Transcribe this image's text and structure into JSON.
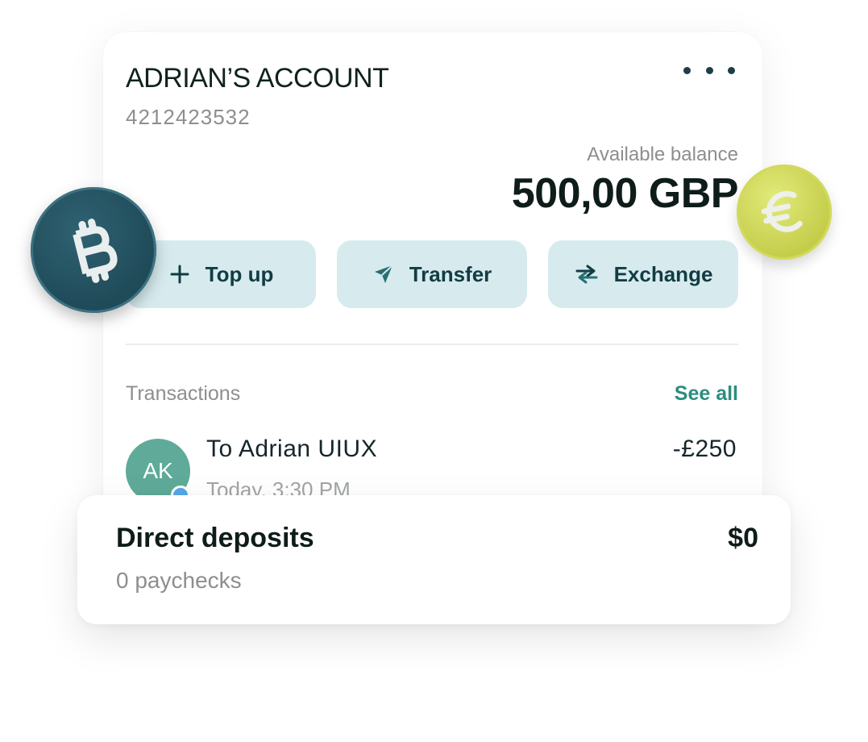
{
  "account": {
    "title": "ADRIAN’S ACCOUNT",
    "number": "4212423532",
    "more_icon": "more-horizontal-icon"
  },
  "balance": {
    "label": "Available balance",
    "value": "500,00 GBP"
  },
  "actions": [
    {
      "label": "Top up",
      "icon": "plus-icon"
    },
    {
      "label": "Transfer",
      "icon": "send-icon"
    },
    {
      "label": "Exchange",
      "icon": "swap-icon"
    }
  ],
  "transactions": {
    "label": "Transactions",
    "see_all": "See all",
    "items": [
      {
        "avatar": "AK",
        "name": "To Adrian UIUX",
        "time": "Today, 3:30 PM",
        "amount": "-£250"
      }
    ]
  },
  "direct_deposits": {
    "title": "Direct deposits",
    "subtitle": "0 paychecks",
    "amount": "$0"
  },
  "decorations": {
    "bitcoin_coin": "bitcoin-coin-icon",
    "euro_coin": "euro-coin-icon"
  },
  "colors": {
    "action_bg": "#d7ebee",
    "accent_green": "#2a8e7d",
    "avatar_bg": "#5faa99",
    "bitcoin_coin": "#1f4a58",
    "euro_coin": "#c4cd4a"
  }
}
